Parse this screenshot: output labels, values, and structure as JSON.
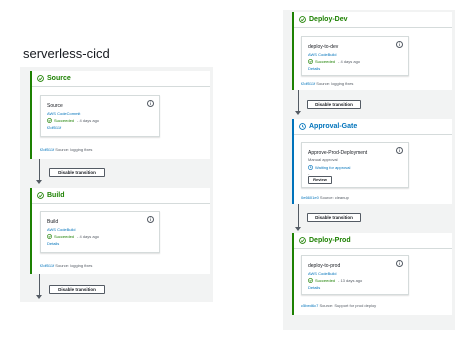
{
  "pipeline": {
    "title": "serverless-cicd"
  },
  "left_column": {
    "source_stage": {
      "name": "Source",
      "action": {
        "name": "Source",
        "provider": "AWS CodeCommit",
        "status": "Succeeded",
        "ago": "- 4 days ago",
        "commit": "f2df511f"
      },
      "source_line": {
        "commit": "f2df511f",
        "text": "Source: logging fixes"
      }
    },
    "transition_1": {
      "label": "Disable transition"
    },
    "build_stage": {
      "name": "Build",
      "action": {
        "name": "Build",
        "provider": "AWS CodeBuild",
        "status": "Succeeded",
        "ago": "- 4 days ago",
        "details": "Details"
      },
      "source_line": {
        "commit": "f2df511f",
        "text": "Source: logging fixes"
      }
    },
    "transition_2": {
      "label": "Disable transition"
    }
  },
  "right_column": {
    "deploy_dev_stage": {
      "name": "Deploy-Dev",
      "action": {
        "name": "deploy-to-dev",
        "provider": "AWS CodeBuild",
        "status": "Succeeded",
        "ago": "- 4 days ago",
        "details": "Details"
      },
      "source_line": {
        "commit": "f2df511f",
        "text": "Source: logging fixes"
      }
    },
    "transition_1": {
      "label": "Disable transition"
    },
    "approval_stage": {
      "name": "Approval-Gate",
      "action": {
        "name": "Approve-Prod-Deployment",
        "provider": "Manual approval",
        "status": "Waiting for approval",
        "dash": "-",
        "review": "Review"
      },
      "source_line": {
        "commit": "0e6601e0",
        "text": "Source: cleanup"
      }
    },
    "transition_2": {
      "label": "Disable transition"
    },
    "deploy_prod_stage": {
      "name": "Deploy-Prod",
      "action": {
        "name": "deploy-to-prod",
        "provider": "AWS CodeBuild",
        "status": "Succeeded",
        "ago": "- 13 days ago",
        "details": "Details"
      },
      "source_line": {
        "commit": "c5bed6c7",
        "text": "Source: Support for prod deploy"
      }
    }
  },
  "colors": {
    "success": "#1d8102",
    "info": "#0073bb",
    "text": "#16191f",
    "muted": "#545b64",
    "panel": "#f2f3f3"
  },
  "icons": {
    "success": "check-circle-icon",
    "pending": "clock-circle-icon",
    "info": "info-icon"
  }
}
